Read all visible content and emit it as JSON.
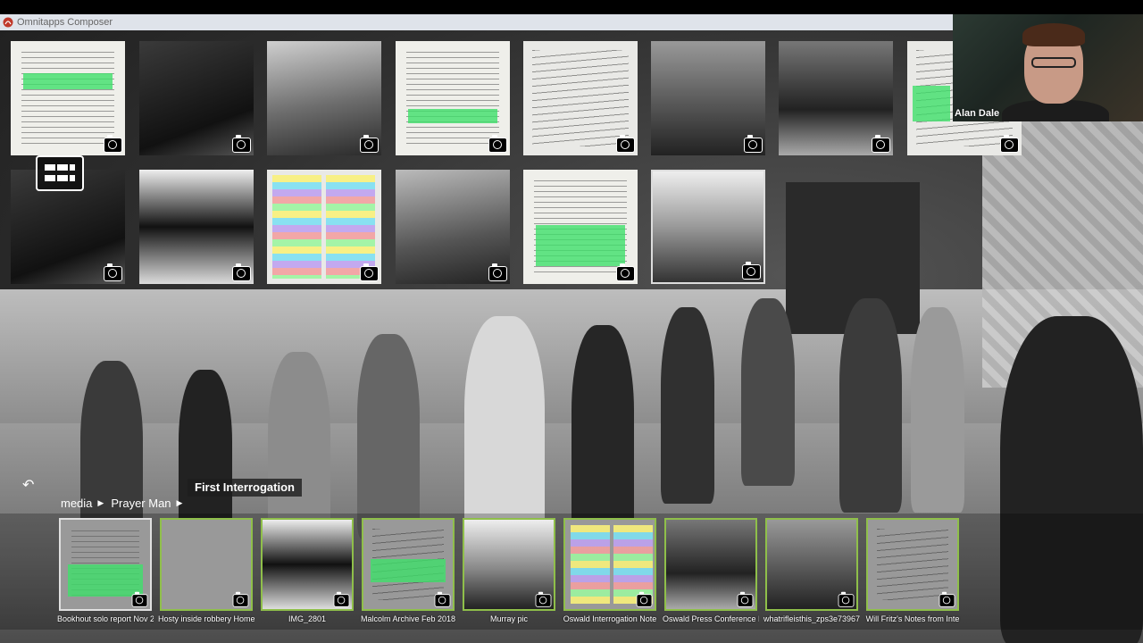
{
  "app": {
    "title": "Omnitapps Composer"
  },
  "video": {
    "participant_name": "Alan Dale"
  },
  "navigation": {
    "current_item": "First Interrogation",
    "breadcrumb": [
      "media",
      "Prayer Man"
    ]
  },
  "filmstrip": {
    "items": [
      {
        "label": "Bookhout solo report Nov 2"
      },
      {
        "label": "Hosty inside robbery Home"
      },
      {
        "label": "IMG_2801"
      },
      {
        "label": "Malcolm Archive Feb 2018"
      },
      {
        "label": "Murray pic"
      },
      {
        "label": "Oswald Interrogation Note"
      },
      {
        "label": "Oswald Press Conference N"
      },
      {
        "label": "whatrifleisthis_zps3e73967"
      },
      {
        "label": "Will Fritz's Notes from Inte"
      }
    ]
  },
  "colors": {
    "filmstrip_border": "#8fbf4a",
    "highlight": "#3fe06a"
  }
}
